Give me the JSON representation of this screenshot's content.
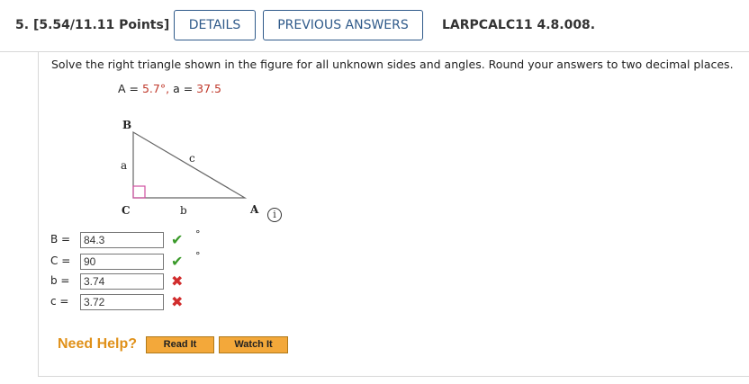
{
  "header": {
    "question_number": "5.",
    "points": "[5.54/11.11 Points]",
    "details_label": "DETAILS",
    "previous_answers_label": "PREVIOUS ANSWERS",
    "problem_code": "LARPCALC11 4.8.008."
  },
  "problem": {
    "prompt": "Solve the right triangle shown in the figure for all unknown sides and angles. Round your answers to two decimal places.",
    "given_A_label": "A = ",
    "given_A_value": "5.7°,",
    "given_a_label": " a = ",
    "given_a_value": "37.5"
  },
  "figure": {
    "vertex_B": "B",
    "vertex_C": "C",
    "vertex_A": "A",
    "side_a": "a",
    "side_b": "b",
    "side_c": "c",
    "info_icon": "info-icon",
    "right_angle_color": "#d04fa0"
  },
  "answers": [
    {
      "label": "B =",
      "value": "84.3",
      "status": "correct",
      "unit": "°"
    },
    {
      "label": "C =",
      "value": "90",
      "status": "correct",
      "unit": "°"
    },
    {
      "label": "b =",
      "value": "3.74",
      "status": "incorrect",
      "unit": ""
    },
    {
      "label": "c =",
      "value": "3.72",
      "status": "incorrect",
      "unit": ""
    }
  ],
  "help": {
    "need_help": "Need Help?",
    "read_it": "Read It",
    "watch_it": "Watch It"
  },
  "colors": {
    "accent": "#2f5a8a",
    "correct": "#3a9a2a",
    "incorrect": "#d12d2d",
    "given_value": "#c0392b",
    "help_button": "#f3a83a"
  }
}
